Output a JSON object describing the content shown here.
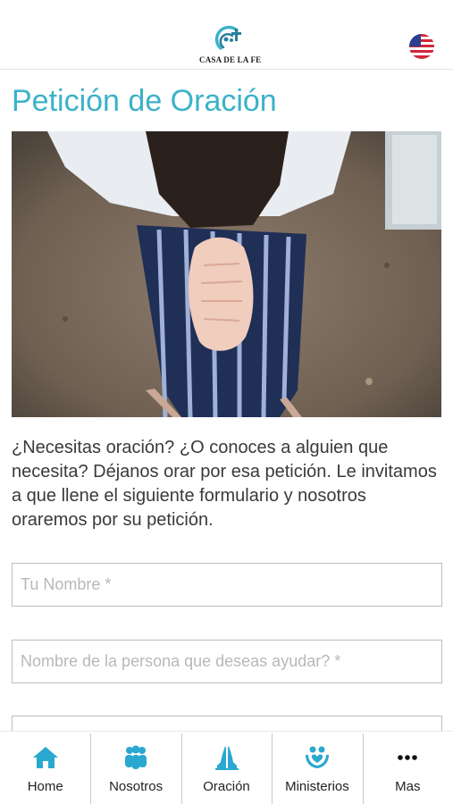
{
  "header": {
    "logo_text": "CASA DE LA FE",
    "language_flag_icon": "us-flag-icon"
  },
  "page": {
    "title": "Petición de Oración",
    "intro_text": "¿Necesitas oración? ¿O conoces a alguien que necesita? Déjanos orar por esa petición. Le invitamos a que llene el siguiente formulario y nosotros oraremos por su petición."
  },
  "form": {
    "name_placeholder": "Tu Nombre *",
    "person_placeholder": "Nombre de la persona que deseas ayudar? *",
    "third_placeholder": ""
  },
  "tabbar": {
    "items": [
      {
        "label": "Home",
        "icon": "home-icon"
      },
      {
        "label": "Nosotros",
        "icon": "people-icon"
      },
      {
        "label": "Oración",
        "icon": "praying-hands-icon"
      },
      {
        "label": "Ministerios",
        "icon": "ministries-icon"
      },
      {
        "label": "Mas",
        "icon": "more-icon"
      }
    ]
  },
  "colors": {
    "accent": "#3bb2c9",
    "text": "#3a3a3a",
    "border": "#bdbdbd"
  }
}
